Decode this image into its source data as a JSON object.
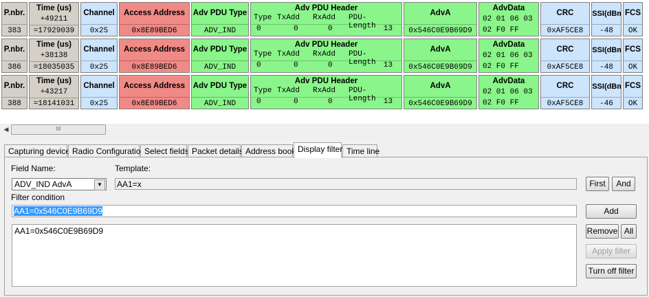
{
  "columns": {
    "pnbr": "P.nbr.",
    "time": "Time (us)",
    "channel": "Channel",
    "access_address": "Access Address",
    "adv_pdu_type": "Adv PDU Type",
    "adv_pdu_header": "Adv PDU Header",
    "header_fields": [
      "Type",
      "TxAdd",
      "RxAdd",
      "PDU-Length"
    ],
    "adva": "AdvA",
    "advdata": "AdvData",
    "crc": "CRC",
    "rssi_line1": "RSSI",
    "rssi_line2": "(dBm)",
    "fcs": "FCS"
  },
  "packets": [
    {
      "pnbr": "383",
      "delta": "+49211",
      "time": "=17929039",
      "channel": "0x25",
      "access_address": "0x8E89BED6",
      "adv_pdu_type": "ADV_IND",
      "type": "0",
      "txadd": "0",
      "rxadd": "0",
      "pdu_length": "13",
      "adva": "0x546C0E9B69D9",
      "advdata_1": "02 01 06 03",
      "advdata_2": "02 F0 FF",
      "crc": "0xAF5CE8",
      "rssi": "-48",
      "fcs": "OK"
    },
    {
      "pnbr": "386",
      "delta": "+38138",
      "time": "=18035035",
      "channel": "0x25",
      "access_address": "0x8E89BED6",
      "adv_pdu_type": "ADV_IND",
      "type": "0",
      "txadd": "0",
      "rxadd": "0",
      "pdu_length": "13",
      "adva": "0x546C0E9B69D9",
      "advdata_1": "02 01 06 03",
      "advdata_2": "02 F0 FF",
      "crc": "0xAF5CE8",
      "rssi": "-48",
      "fcs": "OK"
    },
    {
      "pnbr": "388",
      "delta": "+43217",
      "time": "=18141031",
      "channel": "0x25",
      "access_address": "0x8E89BED6",
      "adv_pdu_type": "ADV_IND",
      "type": "0",
      "txadd": "0",
      "rxadd": "0",
      "pdu_length": "13",
      "adva": "0x546C0E9B69D9",
      "advdata_1": "02 01 06 03",
      "advdata_2": "02 F0 FF",
      "crc": "0xAF5CE8",
      "rssi": "-46",
      "fcs": "OK"
    }
  ],
  "colors": {
    "gray": "#d4d0c8",
    "blue": "#cce4fc",
    "red": "#f08a86",
    "green": "#8af58a"
  },
  "scrollbar": {
    "thumb_grip": "III"
  },
  "tabs": [
    "Capturing device",
    "Radio Configuration",
    "Select fields",
    "Packet details",
    "Address book",
    "Display filter",
    "Time line"
  ],
  "active_tab": "Display filter",
  "filter": {
    "field_name_label": "Field Name:",
    "field_name_value": "ADV_IND AdvA",
    "template_label": "Template:",
    "template_value": "AA1=x",
    "filter_condition_label": "Filter condition",
    "filter_condition_value": "AA1=0x546C0E9B69D9",
    "list_items": [
      "AA1=0x546C0E9B69D9"
    ],
    "buttons": {
      "first": "First",
      "and": "And",
      "add": "Add",
      "remove": "Remove",
      "all": "All",
      "apply": "Apply filter",
      "turn_off": "Turn off filter"
    }
  }
}
